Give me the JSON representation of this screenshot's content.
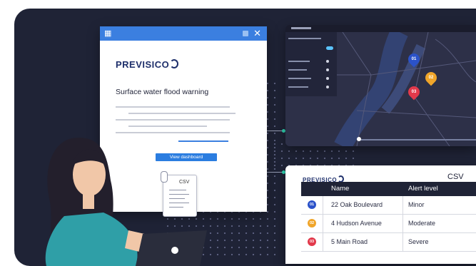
{
  "email": {
    "brand": "PREVISICO",
    "subject": "Surface water flood warning",
    "button_label": "View dashboard",
    "attachment_label": "CSV"
  },
  "map": {
    "markers": [
      {
        "label": "01",
        "color": "#2b52c9"
      },
      {
        "label": "02",
        "color": "#f0a52a"
      },
      {
        "label": "03",
        "color": "#e2394b"
      }
    ]
  },
  "table_window": {
    "brand": "PREVISICO",
    "title": "CSV",
    "columns": [
      "Name",
      "Alert level"
    ],
    "rows": [
      {
        "icon": "01",
        "color": "#2b52c9",
        "name": "22 Oak Boulevard",
        "level": "Minor"
      },
      {
        "icon": "02",
        "color": "#f0a52a",
        "name": "4 Hudson Avenue",
        "level": "Moderate"
      },
      {
        "icon": "03",
        "color": "#e2394b",
        "name": "5 Main Road",
        "level": "Severe"
      }
    ]
  },
  "colors": {
    "background": "#1f2336",
    "accent": "#2b7de0",
    "connector_dot": "#2fd2b0"
  }
}
